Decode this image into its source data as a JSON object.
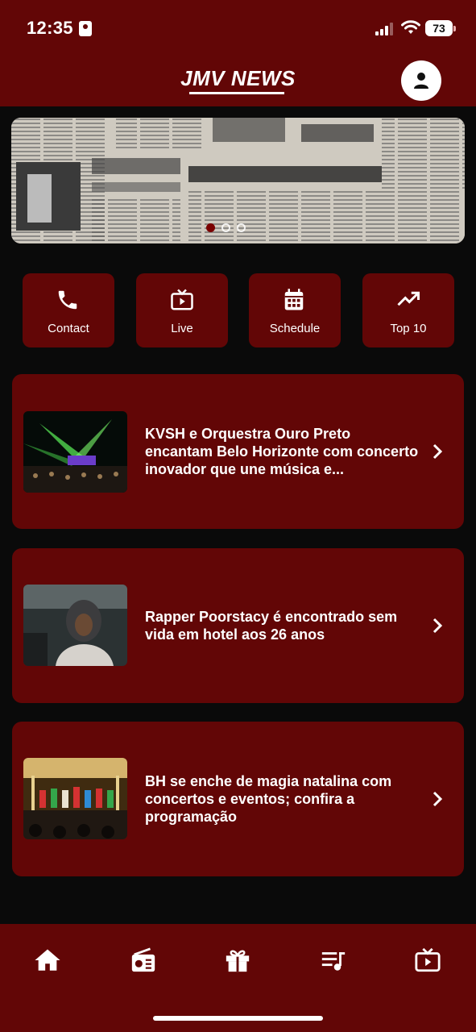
{
  "status_bar": {
    "time": "12:35",
    "battery": "73"
  },
  "header": {
    "logo": "JMV NEWS"
  },
  "quick_actions": [
    {
      "label": "Contact",
      "icon": "phone-icon"
    },
    {
      "label": "Live",
      "icon": "tv-icon"
    },
    {
      "label": "Schedule",
      "icon": "calendar-icon"
    },
    {
      "label": "Top 10",
      "icon": "trending-up-icon"
    }
  ],
  "news": [
    {
      "title": "KVSH e Orquestra Ouro Preto encantam Belo Horizonte com concerto inovador que une música e..."
    },
    {
      "title": "Rapper Poorstacy é encontrado sem vida em hotel aos 26 anos"
    },
    {
      "title": "BH se enche de magia natalina com concertos e eventos; confira a programação"
    }
  ],
  "bottom_nav": [
    {
      "icon": "home-icon"
    },
    {
      "icon": "radio-icon"
    },
    {
      "icon": "gift-icon"
    },
    {
      "icon": "playlist-icon"
    },
    {
      "icon": "tv-icon"
    }
  ],
  "carousel": {
    "slide_count": 3,
    "active_index": 0
  },
  "colors": {
    "primary": "#620606",
    "background": "#0a0a0a",
    "text": "#ffffff"
  }
}
